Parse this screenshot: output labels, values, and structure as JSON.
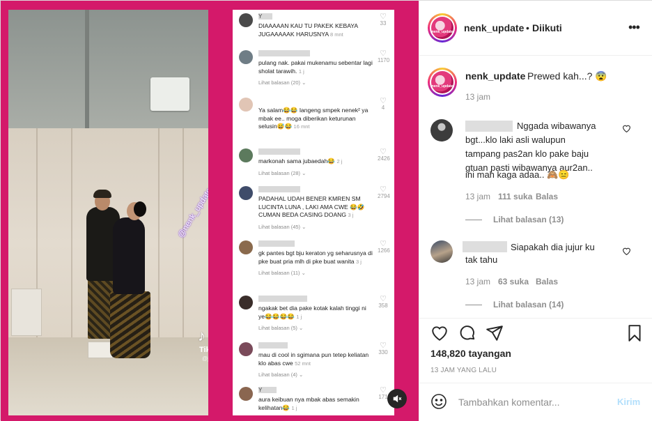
{
  "media": {
    "watermark": "@nenk_update",
    "tiktok_logo": "♪",
    "tiktok_text": "TikT",
    "tiktok_handle": "@jc",
    "mute_icon": "speaker-muted-icon"
  },
  "video_comments": [
    {
      "name": "Y",
      "text": "DIAAAAAN KAU TU PAKEK KEBAYA JUGAAAAAK HARUSNYA",
      "time": "8 mnt",
      "likes": "33",
      "replies": ""
    },
    {
      "name": "",
      "text": "pulang nak. pakai mukenamu sebentar lagi sholat tarawih.",
      "time": "1 j",
      "likes": "1170",
      "replies": "Lihat balasan (20)"
    },
    {
      "name": "",
      "text": "Ya salam😂😂 langeng smpek nenek² ya mbak ee.. moga diberikan keturunan selusin😅😂",
      "time": "16 mnt",
      "likes": "4",
      "replies": ""
    },
    {
      "name": "",
      "text": "markonah sama jubaedah😂",
      "time": "2 j",
      "likes": "2426",
      "replies": "Lihat balasan (28)"
    },
    {
      "name": "",
      "text": "PADAHAL UDAH BENER KMREN SM LUCINTA LUNA , LAKI AMA CWE 😂🤣 CUMAN BEDA CASING DOANG",
      "time": "3 j",
      "likes": "2794",
      "replies": "Lihat balasan (45)"
    },
    {
      "name": "",
      "text": "gk pantes bgt bju keraton yg seharusnya di pke buat pria mlh di pke buat wanita",
      "time": "3 j",
      "likes": "1266",
      "replies": "Lihat balasan (11)"
    },
    {
      "name": "",
      "text": "ngakak bet dia pake kotak kalah tinggi ni ye😂😂😂😂",
      "time": "1 j",
      "likes": "358",
      "replies": "Lihat balasan (5)"
    },
    {
      "name": "",
      "text": "mau di cool in sgimana pun tetep keliatan klo abas cwe",
      "time": "52 mnt",
      "likes": "330",
      "replies": "Lihat balasan (4)"
    },
    {
      "name": "Y",
      "text": "aura keibuan nya mbak abas semakin kelihatan😂",
      "time": "1 j",
      "likes": "171",
      "replies": ""
    }
  ],
  "header": {
    "username": "nenk_update",
    "dot": "•",
    "follow_status": "Diikuti",
    "more_icon": "•••",
    "avatar_label": "nenk_update"
  },
  "caption": {
    "username": "nenk_update",
    "text": "Prewed kah...? 😨",
    "time": "13 jam"
  },
  "comments": [
    {
      "text_lines": [
        "Nggada wibawanya",
        "bgt...klo laki asli walupun",
        "tampang pas2an klo pake baju",
        "gtuan pasti wibawanya aur2an..",
        "ini mah kaga adaa.. 🙈😑"
      ],
      "time": "13 jam",
      "likes": "111 suka",
      "reply": "Balas",
      "replies": "Lihat balasan (13)"
    },
    {
      "text_lines": [
        "Siapakah dia jujur ku",
        "tak tahu"
      ],
      "time": "13 jam",
      "likes": "63 suka",
      "reply": "Balas",
      "replies": "Lihat balasan (14)"
    }
  ],
  "actions": {
    "views": "148,820 tayangan",
    "ago": "13 JAM YANG LALU",
    "comment_placeholder": "Tambahkan komentar...",
    "post_label": "Kirim"
  },
  "colors": {
    "brand_pink": "#d4196a",
    "post_disabled": "#b2dffc"
  }
}
